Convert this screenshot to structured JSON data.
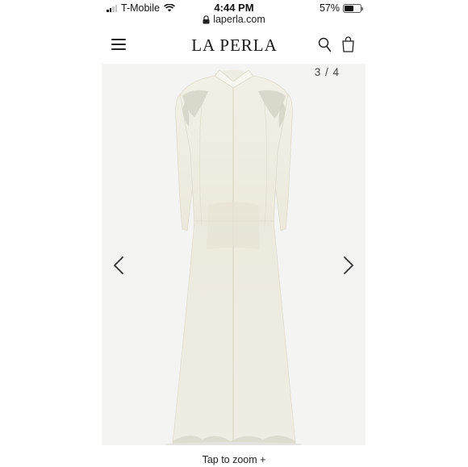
{
  "status_bar": {
    "carrier": "T-Mobile",
    "time": "4:44 PM",
    "battery_percent": "57%",
    "battery_level": 0.57,
    "signal_bars": 2
  },
  "browser": {
    "url": "laperla.com"
  },
  "header": {
    "logo": "LA PERLA",
    "menu_icon": "hamburger-menu-icon",
    "search_icon": "search-icon",
    "bag_icon": "shopping-bag-icon"
  },
  "gallery": {
    "counter": "3 / 4",
    "prev_icon": "chevron-left-icon",
    "next_icon": "chevron-right-icon",
    "background_color": "#f3f3f3"
  },
  "footer": {
    "tap_to_zoom": "Tap to zoom +"
  }
}
